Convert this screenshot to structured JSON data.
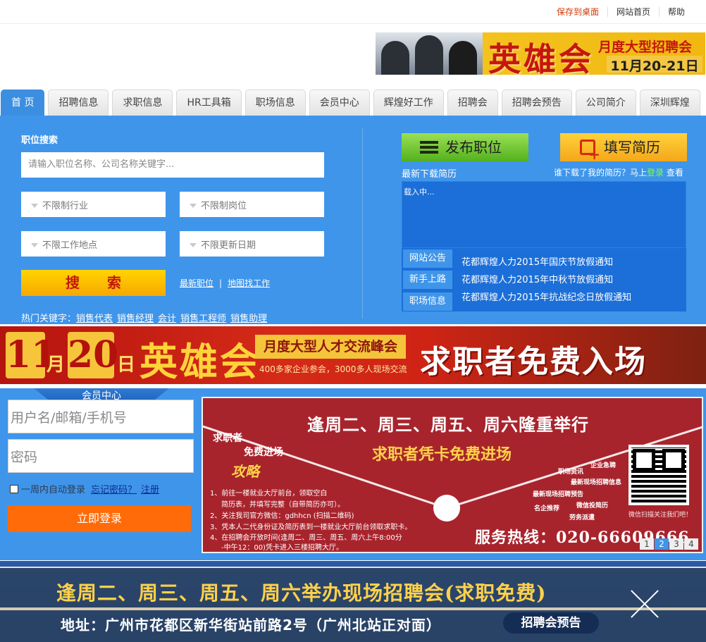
{
  "topbar": {
    "links": [
      "保存到桌面",
      "网站首页",
      "帮助"
    ]
  },
  "header_ad": {
    "title": "英雄会",
    "subtitle": "月度大型招聘会",
    "date": "11月20-21日"
  },
  "nav": {
    "tabs": [
      "首 页",
      "招聘信息",
      "求职信息",
      "HR工具箱",
      "职场信息",
      "会员中心",
      "辉煌好工作",
      "招聘会",
      "招聘会预告",
      "公司简介",
      "深圳辉煌"
    ],
    "active_index": 0
  },
  "search": {
    "section_label": "职位搜索",
    "keyword_placeholder": "请输入职位名称、公司名称关键字...",
    "industry": "不限制行业",
    "position": "不限制岗位",
    "location": "不限工作地点",
    "update_date": "不限更新日期",
    "button": "搜 索",
    "latest_jobs": "最新职位",
    "separator": "|",
    "map_jobs": "地图找工作",
    "hot_label": "热门关键字：",
    "hot_keywords": [
      "销售代表",
      "销售经理",
      "会计",
      "销售工程师",
      "销售助理"
    ]
  },
  "actions": {
    "post_job": "发布职位",
    "fill_resume": "填写简历",
    "downloads_title": "最新下载简历",
    "who_downloaded": "谁下载了我的简历？马上",
    "login_link": "登录",
    "view": "查看",
    "loading": "载入中..."
  },
  "notices": {
    "tabs": [
      "网站公告",
      "新手上路",
      "职场信息"
    ],
    "items": [
      "花都辉煌人力2015年国庆节放假通知",
      "花都辉煌人力2015年中秋节放假通知",
      "花都辉煌人力2015年抗战纪念日放假通知"
    ]
  },
  "mid_ad": {
    "day1": "11",
    "month": "月",
    "day2": "20",
    "unit": "日",
    "hero": "英雄会",
    "tag": "月度大型人才交流峰会",
    "desc": "400多家企业参会，3000多人现场交流",
    "slogan": "求职者免费入场"
  },
  "member": {
    "title": "会员中心",
    "username_placeholder": "用户名/邮箱/手机号",
    "password_placeholder": "密码",
    "remember": "一周内自动登录",
    "forgot": "忘记密码？",
    "register": "注册",
    "login_button": "立即登录"
  },
  "poster": {
    "headline": "逢周二、周三、周五、周六隆重举行",
    "yellow": "求职者凭卡免费进场",
    "seeker": "求职者",
    "free": "免费进场",
    "guide": "攻略",
    "steps": [
      "1、前往一楼就业大厅前台，领取空白",
      "简历表，并填写完整（自带简历亦可）。",
      "2、关注我司官方微信：gdhhcn (扫描二维码)",
      "3、凭本人二代身份证及简历表到一楼就业大厅前台领取求职卡。",
      "4、在招聘会开放时间(逢周二、周三、周五、周六上午8:00分",
      "-中午12：00)凭卡进入三楼招聘大厅。"
    ],
    "side_labels": [
      "企业急聘",
      "职场资讯",
      "最新现场招聘信息",
      "最新现场招聘预告",
      "微信投简历",
      "名企推荐",
      "劳务派遣"
    ],
    "qr_caption": "微信扫描关注我们吧！",
    "hotline": "服务热线：020-66609666",
    "pages": [
      "1",
      "2",
      "3",
      "4"
    ],
    "active_page": 1
  },
  "bottom": {
    "line1": "逢周二、周三、周五、周六举办现场招聘会(求职免费)",
    "line2": "地址：广州市花都区新华街站前路2号（广州北站正对面）",
    "preview_button": "招聘会预告"
  }
}
